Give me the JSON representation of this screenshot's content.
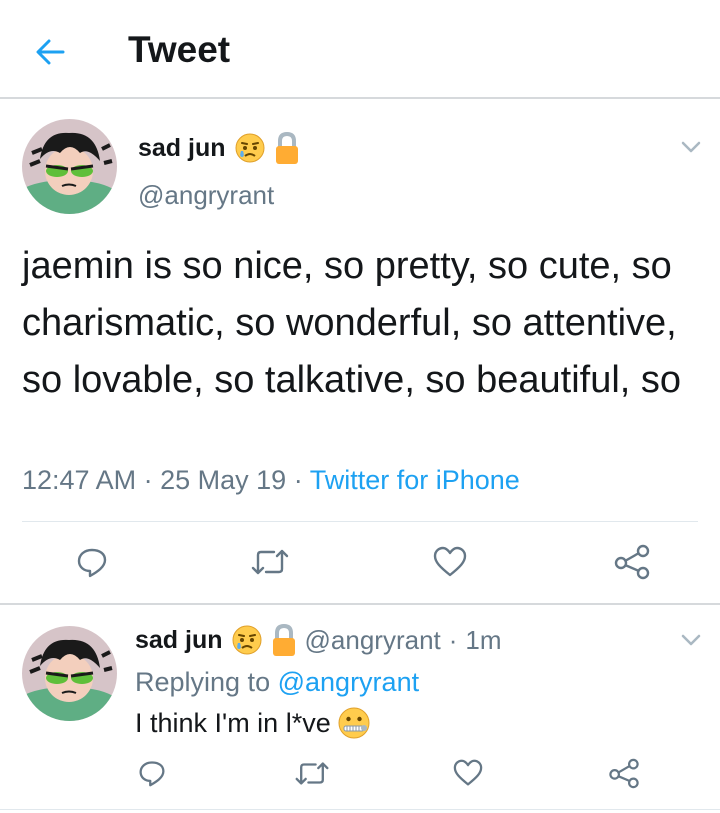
{
  "header": {
    "title": "Tweet"
  },
  "tweet": {
    "name": "sad jun",
    "handle": "@angryrant",
    "text": "jaemin is so nice, so pretty, so cute, so charismatic, so wonderful, so attentive, so lovable, so talkative, so beautiful, so",
    "time": "12:47 AM",
    "date": "25 May 19",
    "source": "Twitter for iPhone",
    "sep": "·"
  },
  "reply": {
    "name": "sad jun",
    "handle": "@angryrant",
    "sep": "·",
    "age": "1m",
    "replying_prefix": "Replying to",
    "replying_to": "@angryrant",
    "text": "I think I'm in l*ve"
  },
  "icons": {
    "back": "back-arrow-icon",
    "name_emoji": "disappointed-relieved-face-emoji",
    "name_lock": "lock-emoji",
    "reply_emoji": "zipper-mouth-face-emoji",
    "actions": [
      "reply-icon",
      "retweet-icon",
      "like-icon",
      "share-icon"
    ]
  },
  "colors": {
    "accent": "#1da1f2",
    "secondary_text": "#657786",
    "divider": "#d6d9dc"
  }
}
